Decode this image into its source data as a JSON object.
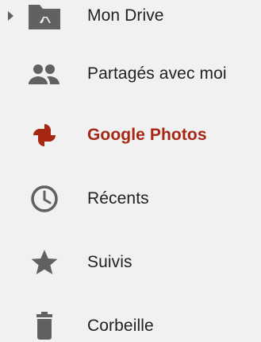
{
  "sidebar": {
    "items": [
      {
        "label": "Mon Drive",
        "icon": "drive-folder-icon",
        "has_expander": true
      },
      {
        "label": "Partagés avec moi",
        "icon": "people-icon"
      },
      {
        "label": "Google Photos",
        "icon": "google-photos-icon",
        "active": true
      },
      {
        "label": "Récents",
        "icon": "clock-icon"
      },
      {
        "label": "Suivis",
        "icon": "star-icon"
      },
      {
        "label": "Corbeille",
        "icon": "trash-icon"
      }
    ]
  },
  "colors": {
    "background": "#f1f1f1",
    "text": "#212121",
    "icon": "#616161",
    "active": "#a52714"
  }
}
